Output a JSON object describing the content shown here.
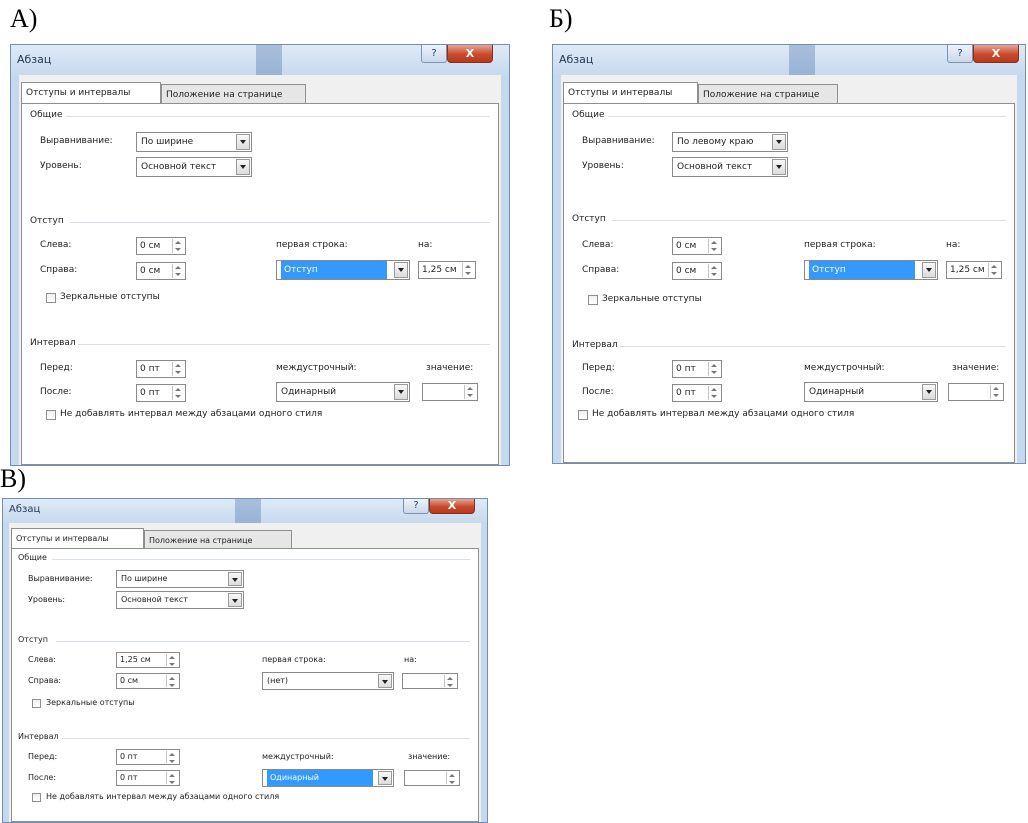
{
  "captions": {
    "a": "А)",
    "b": "Б)",
    "c": "В)"
  },
  "colors": {
    "title_bar": "#c7d9ee",
    "close_button": "#c74a2c",
    "selection": "#3399ff"
  },
  "icons": {
    "help": "question-icon",
    "close": "close-x-icon",
    "dropdown": "chevron-down-icon",
    "spin": "spin-arrows-icon"
  },
  "dialogs": [
    {
      "title": "Абзац",
      "help_label": "?",
      "close_label": "X",
      "tabs": [
        "Отступы и интервалы",
        "Положение на странице"
      ],
      "general": {
        "group": "Общие",
        "alignment_label": "Выравнивание:",
        "alignment_value": "По ширине",
        "level_label": "Уровень:",
        "level_value": "Основной текст"
      },
      "indent": {
        "group": "Отступ",
        "left_label": "Слева:",
        "left_value": "0 см",
        "right_label": "Справа:",
        "right_value": "0 см",
        "first_line_label": "первая строка:",
        "first_line_value": "Отступ",
        "by_label": "на:",
        "by_value": "1,25 см",
        "mirror_label": "Зеркальные отступы"
      },
      "spacing": {
        "group": "Интервал",
        "before_label": "Перед:",
        "before_value": "0 пт",
        "after_label": "После:",
        "after_value": "0 пт",
        "line_label": "междустрочный:",
        "line_value": "Одинарный",
        "value_label": "значение:",
        "value_value": "",
        "no_space_label": "Не добавлять интервал между абзацами одного стиля"
      }
    },
    {
      "title": "Абзац",
      "help_label": "?",
      "close_label": "X",
      "tabs": [
        "Отступы и интервалы",
        "Положение на странице"
      ],
      "general": {
        "group": "Общие",
        "alignment_label": "Выравнивание:",
        "alignment_value": "По левому краю",
        "level_label": "Уровень:",
        "level_value": "Основной текст"
      },
      "indent": {
        "group": "Отступ",
        "left_label": "Слева:",
        "left_value": "0 см",
        "right_label": "Справа:",
        "right_value": "0 см",
        "first_line_label": "первая строка:",
        "first_line_value": "Отступ",
        "by_label": "на:",
        "by_value": "1,25 см",
        "mirror_label": "Зеркальные отступы"
      },
      "spacing": {
        "group": "Интервал",
        "before_label": "Перед:",
        "before_value": "0 пт",
        "after_label": "После:",
        "after_value": "0 пт",
        "line_label": "междустрочный:",
        "line_value": "Одинарный",
        "value_label": "значение:",
        "value_value": "",
        "no_space_label": "Не добавлять интервал между абзацами одного стиля"
      }
    },
    {
      "title": "Абзац",
      "help_label": "?",
      "close_label": "X",
      "tabs": [
        "Отступы и интервалы",
        "Положение на странице"
      ],
      "general": {
        "group": "Общие",
        "alignment_label": "Выравнивание:",
        "alignment_value": "По ширине",
        "level_label": "Уровень:",
        "level_value": "Основной текст"
      },
      "indent": {
        "group": "Отступ",
        "left_label": "Слева:",
        "left_value": "1,25 см",
        "right_label": "Справа:",
        "right_value": "0 см",
        "first_line_label": "первая строка:",
        "first_line_value": "(нет)",
        "by_label": "на:",
        "by_value": "",
        "mirror_label": "Зеркальные отступы"
      },
      "spacing": {
        "group": "Интервал",
        "before_label": "Перед:",
        "before_value": "0 пт",
        "after_label": "После:",
        "after_value": "0 пт",
        "line_label": "междустрочный:",
        "line_value": "Одинарный",
        "value_label": "значение:",
        "value_value": "",
        "no_space_label": "Не добавлять интервал между абзацами одного стиля"
      }
    }
  ]
}
